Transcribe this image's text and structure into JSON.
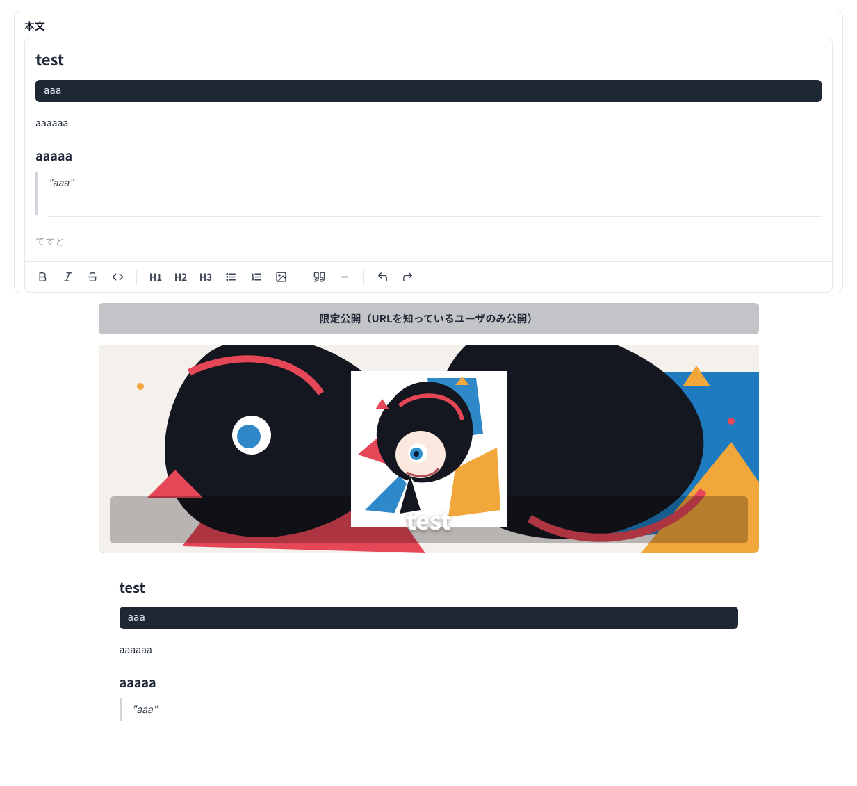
{
  "editor": {
    "panel_label": "本文",
    "content": {
      "h1": "test",
      "code": "aaa",
      "para": "aaaaaa",
      "h2": "aaaaa",
      "blockquote": "\"aaa\"",
      "placeholder": "てすと"
    },
    "toolbar": {
      "h1": "H1",
      "h2": "H2",
      "h3": "H3"
    }
  },
  "visibility": {
    "label": "限定公開（URLを知っているユーザのみ公開）"
  },
  "hero": {
    "title": "test"
  },
  "preview": {
    "h1": "test",
    "code": "aaa",
    "para": "aaaaaa",
    "h2": "aaaaa",
    "blockquote": "\"aaa\""
  }
}
